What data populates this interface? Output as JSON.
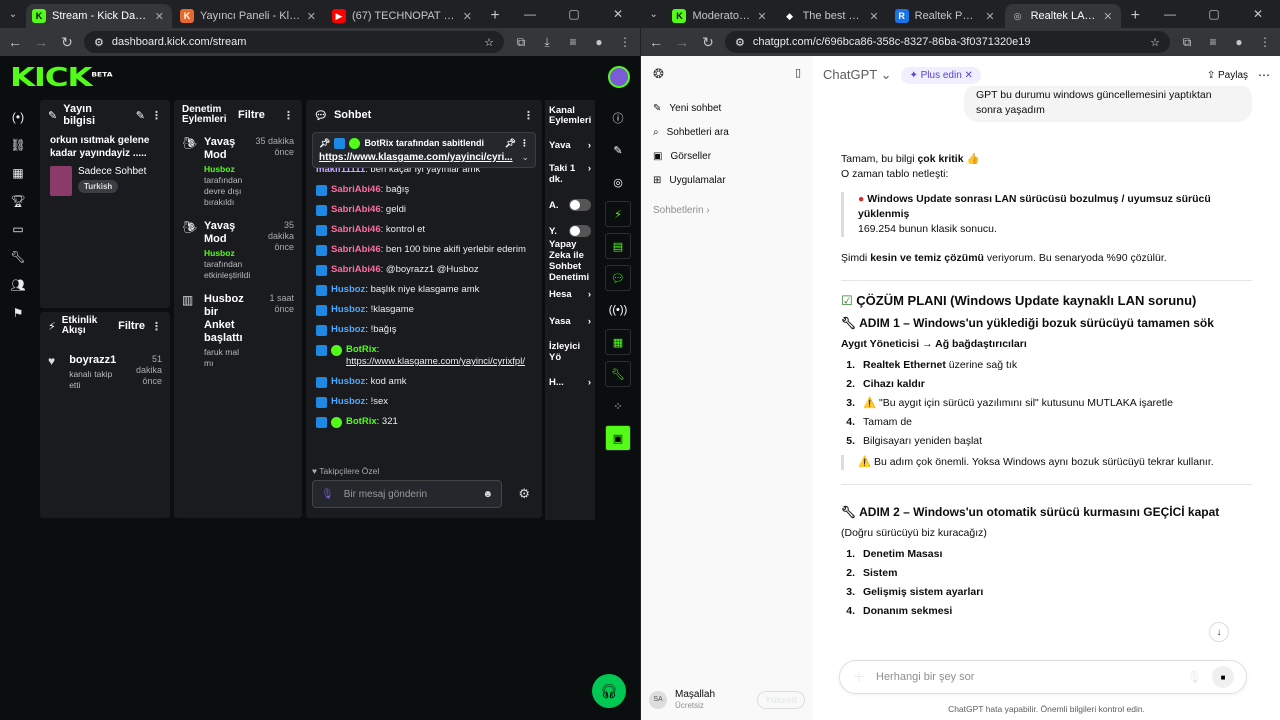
{
  "left": {
    "tabs": [
      {
        "title": "Stream - Kick Dashboard",
        "icon": "K",
        "color": "#53fc18",
        "active": true
      },
      {
        "title": "Yayıncı Paneli - Klasgame.com",
        "icon": "K",
        "color": "#e8692d",
        "active": false
      },
      {
        "title": "(67) TECHNOPAT UEFI WİNDO...",
        "icon": "▶",
        "color": "#ff0000",
        "active": false
      }
    ],
    "url": "dashboard.kick.com/stream",
    "logo": "KICK",
    "logo_beta": "BETA",
    "stream_info": {
      "title": "Yayın bilgisi",
      "desc": "orkun ısıtmak gelene kadar yayındayiz .....",
      "mode": "Sadece Sohbet",
      "tag": "Turkish"
    },
    "mod_actions": {
      "title": "Denetim Eylemleri",
      "filter": "Filtre",
      "items": [
        {
          "title": "Yavaş Mod",
          "time": "35 dakika önce",
          "user": "Husboz",
          "desc": "tarafından devre dışı bırakıldı"
        },
        {
          "title": "Yavaş Mod",
          "time": "35 dakika önce",
          "user": "Husboz",
          "desc": "tarafından etkinleştirildi"
        },
        {
          "title": "Husboz bir Anket başlattı",
          "time": "1 saat önce",
          "user": "",
          "desc": "faruk mal mı"
        }
      ]
    },
    "activity": {
      "title": "Etkinlik Akışı",
      "filter": "Filtre",
      "user": "boyrazz1",
      "time": "51 dakika önce",
      "desc": "kanalı takip etti"
    },
    "chat": {
      "title": "Sohbet",
      "pinned_by": "BotRix tarafından sabitlendi",
      "pinned_link": "https://www.klasgame.com/yayinci/cyri...",
      "messages": [
        {
          "user": "makif11111",
          "text": "ben kaçar iyi yayınlar amk",
          "color": "violet"
        },
        {
          "user": "SabriAbi46",
          "text": "bağış",
          "color": "pink"
        },
        {
          "user": "SabriAbi46",
          "text": "geldi",
          "color": "pink"
        },
        {
          "user": "SabriAbi46",
          "text": "kontrol et",
          "color": "pink"
        },
        {
          "user": "SabriAbi46",
          "text": "ben 100 bine akifi yerlebir ederim",
          "color": "pink"
        },
        {
          "user": "SabriAbi46",
          "text": "@boyrazz1 @Husboz",
          "color": "pink"
        },
        {
          "user": "Husboz",
          "text": "başlık niye klasgame amk",
          "color": "blue"
        },
        {
          "user": "Husboz",
          "text": "!klasgame",
          "color": "blue"
        },
        {
          "user": "Husboz",
          "text": "!bağış",
          "color": "blue"
        },
        {
          "user": "BotRix",
          "text": "https://www.klasgame.com/yayinci/cyrixfpl/",
          "color": "green"
        },
        {
          "user": "Husboz",
          "text": "kod amk",
          "color": "blue"
        },
        {
          "user": "Husboz",
          "text": "!sex",
          "color": "blue"
        },
        {
          "user": "BotRix",
          "text": "321",
          "color": "green"
        }
      ],
      "followers_only": "Takipçilere Özel",
      "placeholder": "Bir mesaj gönderin"
    },
    "channel_actions": {
      "title": "Kanal Eylemleri",
      "items": [
        "Yava",
        "Taki 1 dk.",
        "A.",
        "Y.",
        "Yapay Zeka ile Sohbet Denetimi",
        "Hesa",
        "Yasa",
        "İzleyici Yö",
        "H..."
      ]
    }
  },
  "right": {
    "tabs": [
      {
        "title": "Moderator - Kick D...",
        "icon": "K",
        "color": "#53fc18",
        "active": false
      },
      {
        "title": "The best ChatBot a...",
        "icon": "◆",
        "color": "#fff",
        "active": false
      },
      {
        "title": "Realtek PCIe FE / G...",
        "icon": "R",
        "color": "#1a73e8",
        "active": false
      },
      {
        "title": "Realtek LAN Driver...",
        "icon": "◎",
        "color": "#ccc",
        "active": true
      }
    ],
    "url": "chatgpt.com/c/696bca86-358c-8327-86ba-3f0371320e19",
    "sidebar": {
      "items": [
        "Yeni sohbet",
        "Sohbetleri ara",
        "Görseller",
        "Uygulamalar"
      ],
      "section": "Sohbetlerin ›",
      "user": "Maşallah",
      "plan": "Ücretsiz",
      "initials": "SA",
      "upgrade": "Yükselt"
    },
    "header": {
      "title": "ChatGPT",
      "plus": "Plus edin",
      "share": "Paylaş"
    },
    "user_msg": "GPT bu durumu windows güncellemesini yaptıktan sonra yaşadım",
    "answer": {
      "p1a": "Tamam, bu bilgi ",
      "p1b": "çok kritik",
      "p1c": " 👍",
      "p2": "O zaman tablo netleşti:",
      "quote_bold": "Windows Update sonrası LAN sürücüsü bozulmuş / uyumsuz sürücü yüklenmiş",
      "quote_text": "169.254 bunun klasik sonucu.",
      "p3a": "Şimdi ",
      "p3b": "kesin ve temiz çözümü",
      "p3c": " veriyorum. Bu senaryoda %90 çözülür.",
      "plan": "ÇÖZÜM PLANI (Windows Update kaynaklı LAN sorunu)",
      "step1": "ADIM 1 – Windows'un yüklediği bozuk sürücüyü tamamen sök",
      "step1_path": "Aygıt Yöneticisi → Ağ bağdaştırıcıları",
      "step1_items": [
        {
          "n": "1.",
          "b": "Realtek Ethernet",
          "t": " üzerine sağ tık"
        },
        {
          "n": "2.",
          "b": "Cihazı kaldır",
          "t": ""
        },
        {
          "n": "3.",
          "b": "",
          "t": "⚠️ \"Bu aygıt için sürücü yazılımını sil\" kutusunu MUTLAKA işaretle"
        },
        {
          "n": "4.",
          "b": "",
          "t": "Tamam de"
        },
        {
          "n": "5.",
          "b": "",
          "t": "Bilgisayarı yeniden başlat"
        }
      ],
      "step1_note": "⚠️ Bu adım çok önemli. Yoksa Windows aynı bozuk sürücüyü tekrar kullanır.",
      "step2": "ADIM 2 – Windows'un otomatik sürücü kurmasını GEÇİCİ kapat",
      "step2_sub": "(Doğru sürücüyü biz kuracağız)",
      "step2_items": [
        {
          "n": "1.",
          "t": "Denetim Masası"
        },
        {
          "n": "2.",
          "t": "Sistem"
        },
        {
          "n": "3.",
          "t": "Gelişmiş sistem ayarları"
        },
        {
          "n": "4.",
          "t": "Donanım sekmesi"
        }
      ]
    },
    "input_placeholder": "Herhangi bir şey sor",
    "footer": "ChatGPT hata yapabilir. Önemli bilgileri kontrol edin."
  }
}
